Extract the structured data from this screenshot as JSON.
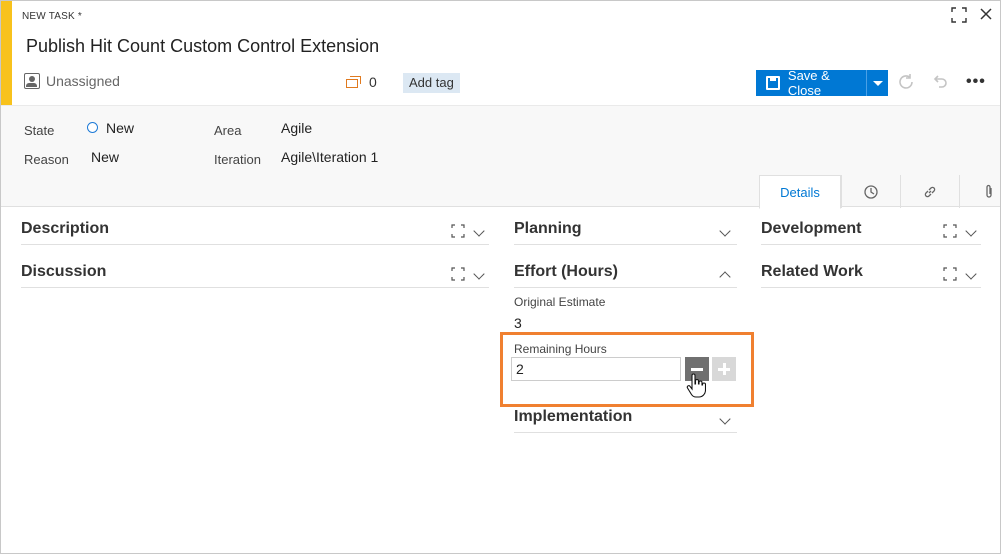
{
  "window": {
    "type_label": "NEW TASK *",
    "title": "Publish Hit Count Custom Control Extension",
    "maximize_icon": "maximize-icon",
    "close_icon": "close-icon"
  },
  "toolbar": {
    "assigned_to": "Unassigned",
    "comment_count": "0",
    "add_tag": "Add tag",
    "save_label": "Save & Close",
    "accent_color": "#0078d4"
  },
  "fields": {
    "state_label": "State",
    "state_value": "New",
    "reason_label": "Reason",
    "reason_value": "New",
    "area_label": "Area",
    "area_value": "Agile",
    "iteration_label": "Iteration",
    "iteration_value": "Agile\\Iteration 1"
  },
  "tabs": [
    {
      "label": "Details",
      "active": true
    },
    {
      "icon": "history-icon"
    },
    {
      "icon": "link-icon"
    },
    {
      "icon": "attachment-icon"
    }
  ],
  "sections": {
    "description": "Description",
    "discussion": "Discussion",
    "planning": "Planning",
    "effort": "Effort (Hours)",
    "implementation": "Implementation",
    "development": "Development",
    "related_work": "Related Work"
  },
  "effort": {
    "original_estimate_label": "Original Estimate",
    "original_estimate_value": "3",
    "remaining_label": "Remaining Hours",
    "remaining_value": "2"
  },
  "highlight_color": "#f08030"
}
